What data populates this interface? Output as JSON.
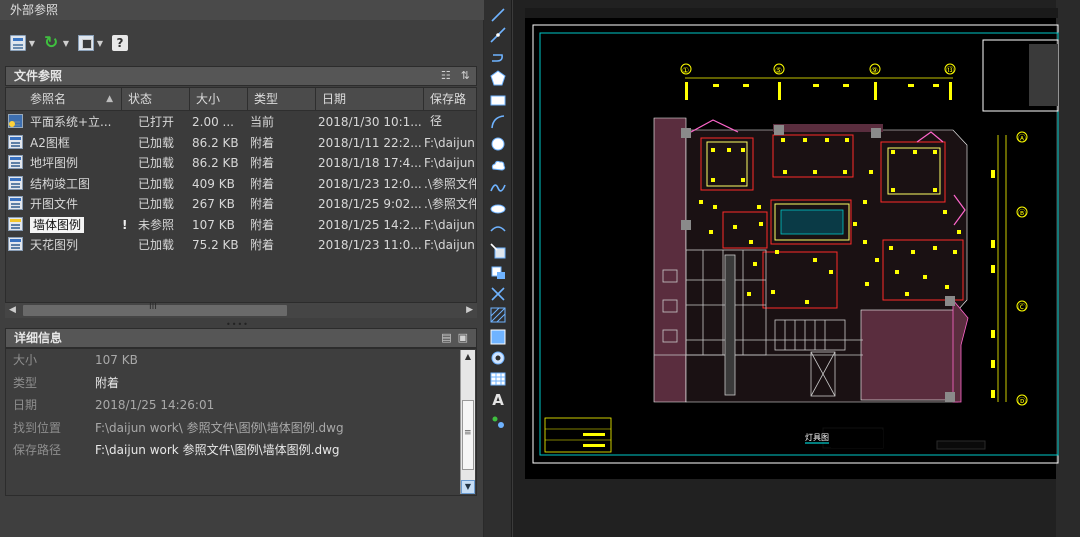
{
  "palette": {
    "title": "外部参照",
    "section_refs": "文件参照",
    "section_details": "详细信息",
    "columns": [
      "参照名",
      "状态",
      "大小",
      "类型",
      "日期",
      "保存路径"
    ],
    "rows": [
      {
        "name": "平面系统+立...",
        "status": "已打开",
        "size": "2.00 ...",
        "type": "当前",
        "date": "2018/1/30 10:1...",
        "path": "",
        "icon": "master-drawing-icon",
        "warn": ""
      },
      {
        "name": "A2图框",
        "status": "已加载",
        "size": "86.2 KB",
        "type": "附着",
        "date": "2018/1/11 22:2...",
        "path": "F:\\daijun",
        "icon": "dwg-reference-icon",
        "warn": ""
      },
      {
        "name": "地坪图例",
        "status": "已加载",
        "size": "86.2 KB",
        "type": "附着",
        "date": "2018/1/18 17:4...",
        "path": "F:\\daijun",
        "icon": "dwg-reference-icon",
        "warn": ""
      },
      {
        "name": "结构竣工图",
        "status": "已加载",
        "size": "409 KB",
        "type": "附着",
        "date": "2018/1/23 12:0...",
        "path": ".\\参照文件",
        "icon": "dwg-reference-icon",
        "warn": ""
      },
      {
        "name": "开图文件",
        "status": "已加载",
        "size": "267 KB",
        "type": "附着",
        "date": "2018/1/25 9:02...",
        "path": ".\\参照文件",
        "icon": "dwg-reference-icon",
        "warn": ""
      },
      {
        "name": "墙体图例",
        "status": "未参照",
        "size": "107 KB",
        "type": "附着",
        "date": "2018/1/25 14:2...",
        "path": "F:\\daijun",
        "icon": "dwg-warning-icon",
        "warn": "!"
      },
      {
        "name": "天花图列",
        "status": "已加载",
        "size": "75.2 KB",
        "type": "附着",
        "date": "2018/1/23 11:0...",
        "path": "F:\\daijun",
        "icon": "dwg-reference-icon",
        "warn": ""
      }
    ],
    "details": [
      {
        "label": "大小",
        "value": "107 KB",
        "strong": false
      },
      {
        "label": "类型",
        "value": "附着",
        "strong": true
      },
      {
        "label": "日期",
        "value": "2018/1/25 14:26:01",
        "strong": false
      },
      {
        "label": "找到位置",
        "value": "F:\\daijun work\\ 参照文件\\图例\\墙体图例.dwg",
        "strong": false
      },
      {
        "label": "保存路径",
        "value": "F:\\daijun work  参照文件\\图例\\墙体图例.dwg",
        "strong": true
      }
    ],
    "hscroll_grip": "III",
    "vscroll_grip": "≡",
    "header_icons_refs": [
      "☷",
      "⇅"
    ],
    "header_icons_details": [
      "▤",
      "▣"
    ]
  },
  "drawing": {
    "grid_top": [
      "①",
      "⑤",
      "⑨",
      "⑬"
    ],
    "grid_right": [
      "Ⓐ",
      "Ⓑ",
      "Ⓒ",
      "Ⓓ"
    ],
    "title_label": "灯具图"
  },
  "vtoolbar": {
    "text_tool": "A"
  },
  "colors": {
    "selection_bg": "#f4f4f4",
    "refresh_green": "#3fbf3f",
    "cad_yellow": "#ffff00",
    "cad_red_wall": "#5a2d3e",
    "cad_cyan": "#00c8c8"
  }
}
